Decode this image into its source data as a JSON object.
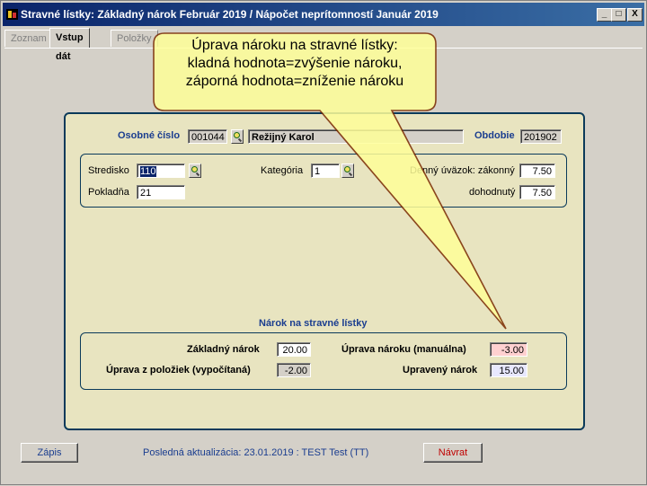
{
  "window": {
    "title": "Stravné lístky:  Základný nárok Február 2019  /  Nápočet neprítomností Január 2019",
    "minimize": "_",
    "maximize": "□",
    "close": "X"
  },
  "tabs": [
    {
      "label": "Zoznam",
      "active": false
    },
    {
      "label": "Vstup dát",
      "active": true
    },
    {
      "label": "Položky",
      "active": false
    }
  ],
  "header": {
    "osobne_cislo_label": "Osobné číslo",
    "osobne_cislo_value": "001044",
    "meno_value": "Režijný Karol",
    "obdobie_label": "Obdobie",
    "obdobie_value": "201902"
  },
  "details": {
    "stredisko_label": "Stredisko",
    "stredisko_value": "110",
    "pokladna_label": "Pokladňa",
    "pokladna_value": "21",
    "kategoria_label": "Kategória",
    "kategoria_value": "1",
    "uvazok_label": "Denný úväzok: zákonný",
    "uvazok_zakonny_value": "7.50",
    "dohodnuty_label": "dohodnutý",
    "uvazok_dohodnuty_value": "7.50"
  },
  "narok": {
    "section_title": "Nárok na stravné lístky",
    "zakladny_label": "Základný nárok",
    "zakladny_value": "20.00",
    "uprava_poloziek_label": "Úprava z položiek (vypočítaná)",
    "uprava_poloziek_value": "-2.00",
    "uprava_manualna_label": "Úprava nároku (manuálna)",
    "uprava_manualna_value": "-3.00",
    "upraveny_label": "Upravený nárok",
    "upraveny_value": "15.00"
  },
  "footer": {
    "zapis_label": "Zápis",
    "aktualizacia_text": "Posledná aktualizácia: 23.01.2019 : TEST Test  (TT)",
    "navrat_label": "Návrat"
  },
  "callout": {
    "line1": "Úprava nároku na stravné lístky:",
    "line2": "kladná hodnota=zvýšenie nároku,",
    "line3": "záporná hodnota=zníženie nároku"
  },
  "colors": {
    "title_gradient_start": "#0a246a",
    "panel_background": "#e8e4c0",
    "panel_border": "#0b3a5a",
    "label_blue": "#1a3d8f",
    "callout_fill": "#ffff99",
    "highlight_pink": "#ffd0d0",
    "highlight_lavender": "#e8e8ff",
    "navrat_red": "#c00000",
    "footer_text_blue": "#1a3d8f"
  }
}
